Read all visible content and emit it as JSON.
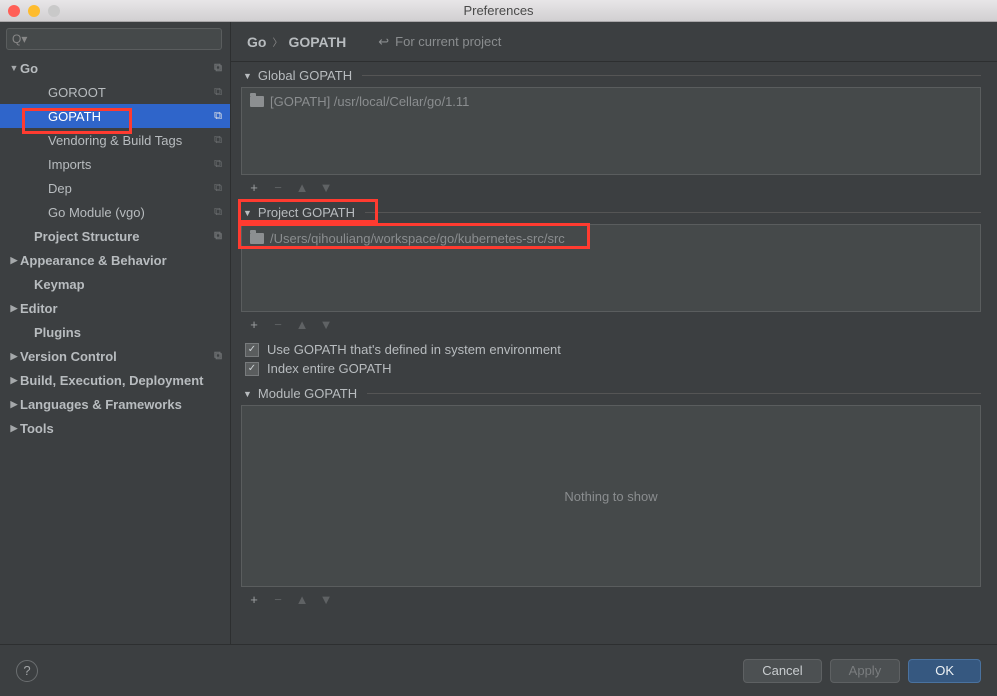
{
  "window": {
    "title": "Preferences"
  },
  "search": {
    "placeholder": ""
  },
  "sidebar": {
    "items": [
      {
        "label": "Go",
        "arrow": "down",
        "bold": true,
        "copy": true,
        "indent": 0
      },
      {
        "label": "GOROOT",
        "arrow": "",
        "bold": false,
        "copy": true,
        "indent": 2
      },
      {
        "label": "GOPATH",
        "arrow": "",
        "bold": false,
        "copy": true,
        "indent": 2,
        "selected": true
      },
      {
        "label": "Vendoring & Build Tags",
        "arrow": "",
        "bold": false,
        "copy": true,
        "indent": 2
      },
      {
        "label": "Imports",
        "arrow": "",
        "bold": false,
        "copy": true,
        "indent": 2
      },
      {
        "label": "Dep",
        "arrow": "",
        "bold": false,
        "copy": true,
        "indent": 2
      },
      {
        "label": "Go Module (vgo)",
        "arrow": "",
        "bold": false,
        "copy": true,
        "indent": 2
      },
      {
        "label": "Project Structure",
        "arrow": "",
        "bold": true,
        "copy": true,
        "indent": 1
      },
      {
        "label": "Appearance & Behavior",
        "arrow": "right",
        "bold": true,
        "copy": false,
        "indent": 0
      },
      {
        "label": "Keymap",
        "arrow": "",
        "bold": true,
        "copy": false,
        "indent": 1
      },
      {
        "label": "Editor",
        "arrow": "right",
        "bold": true,
        "copy": false,
        "indent": 0
      },
      {
        "label": "Plugins",
        "arrow": "",
        "bold": true,
        "copy": false,
        "indent": 1
      },
      {
        "label": "Version Control",
        "arrow": "right",
        "bold": true,
        "copy": true,
        "indent": 0
      },
      {
        "label": "Build, Execution, Deployment",
        "arrow": "right",
        "bold": true,
        "copy": false,
        "indent": 0
      },
      {
        "label": "Languages & Frameworks",
        "arrow": "right",
        "bold": true,
        "copy": false,
        "indent": 0
      },
      {
        "label": "Tools",
        "arrow": "right",
        "bold": true,
        "copy": false,
        "indent": 0
      }
    ]
  },
  "breadcrumb": {
    "root": "Go",
    "page": "GOPATH",
    "for_project_label": "For current project"
  },
  "sections": {
    "global": {
      "title": "Global GOPATH",
      "entry": "[GOPATH] /usr/local/Cellar/go/1.11"
    },
    "project": {
      "title": "Project GOPATH",
      "entry": "/Users/qihouliang/workspace/go/kubernetes-src/src"
    },
    "module": {
      "title": "Module GOPATH",
      "empty_text": "Nothing to show"
    }
  },
  "checkboxes": {
    "use_env": "Use GOPATH that's defined in system environment",
    "index_entire": "Index entire GOPATH"
  },
  "buttons": {
    "cancel": "Cancel",
    "apply": "Apply",
    "ok": "OK"
  },
  "icons": {
    "add": "+",
    "remove": "−",
    "up": "▲",
    "down": "▼",
    "check": "✓",
    "help": "?"
  }
}
